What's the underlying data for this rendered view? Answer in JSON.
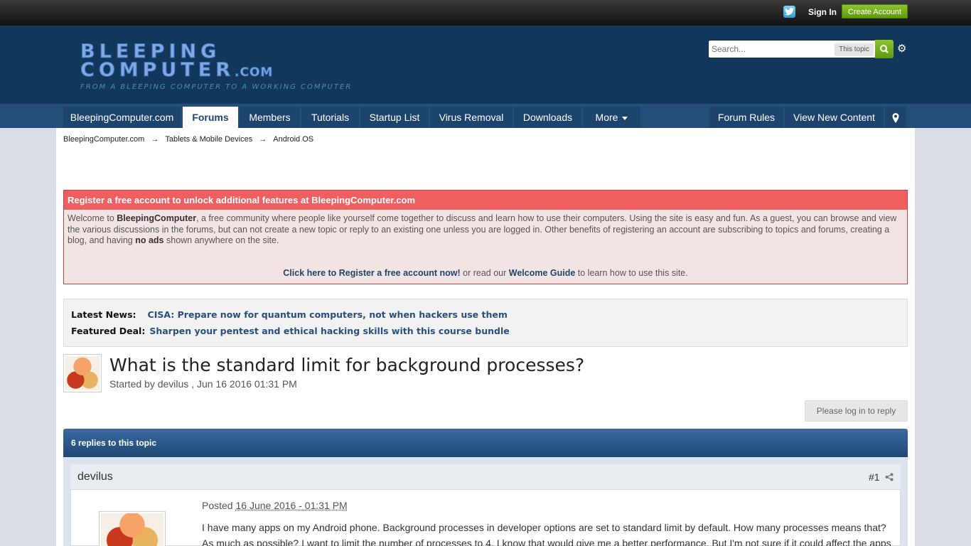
{
  "topbar": {
    "sign_in": "Sign In",
    "create_account": "Create Account"
  },
  "header": {
    "logo_line1": "BLEEPING",
    "logo_line2": "COMPUTER",
    "logo_com": ".COM",
    "tagline": "FROM A BLEEPING COMPUTER TO A WORKING COMPUTER",
    "search_placeholder": "Search...",
    "search_scope": "This topic"
  },
  "nav": {
    "items": [
      {
        "label": "BleepingComputer.com"
      },
      {
        "label": "Forums"
      },
      {
        "label": "Members"
      },
      {
        "label": "Tutorials"
      },
      {
        "label": "Startup List"
      },
      {
        "label": "Virus Removal"
      },
      {
        "label": "Downloads"
      },
      {
        "label": "More"
      }
    ],
    "right_items": [
      {
        "label": "Forum Rules"
      },
      {
        "label": "View New Content"
      }
    ]
  },
  "breadcrumb": [
    "BleepingComputer.com",
    "Tablets & Mobile Devices",
    "Android OS"
  ],
  "register": {
    "heading": "Register a free account to unlock additional features at BleepingComputer.com",
    "p1": "Welcome to ",
    "brand": "BleepingComputer",
    "p2": ", a free community where people like yourself come together to discuss and learn how to use their computers. Using the site is easy and fun. As a guest, you can browse and view the various discussions in the forums, but can not create a new topic or reply to an existing one unless you are logged in. Other benefits of registering an account are subscribing to topics and forums, creating a blog, and having ",
    "no_ads": "no ads",
    "p3": " shown anywhere on the site.",
    "cta_link": "Click here to Register a free account now!",
    "cta_mid": " or read our ",
    "guide_link": "Welcome Guide",
    "cta_end": " to learn how to use this site."
  },
  "news": {
    "latest_label": "Latest News:",
    "latest_text": "CISA: Prepare now for quantum computers, not when hackers use them",
    "deal_label": "Featured Deal:",
    "deal_text": "Sharpen your pentest and ethical hacking skills with this course bundle"
  },
  "topic": {
    "title": "What is the standard limit for background processes?",
    "meta": "Started by devilus , Jun 16 2016 01:31 PM",
    "reply_button": "Please log in to reply",
    "replies": "6 replies to this topic"
  },
  "post": {
    "author": "devilus",
    "number": "#1",
    "posted_label": "Posted ",
    "posted_date": "16 June 2016 - 01:31 PM",
    "body": "I have many apps on my Android phone. Background processes in developer options are set to standard limit by default. How many processes means that? As much as possible? I want to limit the number of processes to 4. I know that would give me a better performance. But I'm not sure if it could affect the apps"
  },
  "colors": {
    "header_bg": "#11385a",
    "nav_bg": "#1d446d",
    "accent_green": "#7ab526",
    "register_red": "#ef5f5f"
  }
}
